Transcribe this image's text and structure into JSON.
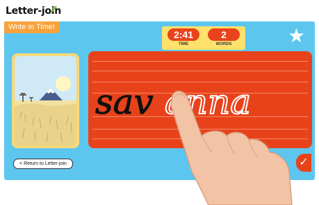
{
  "app": {
    "logo_text": "Letter-join"
  },
  "game": {
    "title": "Write in Time!",
    "hud": {
      "time_value": "2:41",
      "time_label": "TIME",
      "words_value": "2",
      "words_label": "WORDS"
    },
    "word": {
      "traced": "sav",
      "remaining": "anna"
    },
    "back_label": "< Return to Letter-join",
    "icons": [
      "pen-icon",
      "star-icon",
      "check-icon",
      "mountain-picture"
    ]
  },
  "colors": {
    "frame": "#5cc6ef",
    "board": "#e8421a",
    "title_tab": "#f7a23a",
    "hud": "#ffe16b"
  }
}
